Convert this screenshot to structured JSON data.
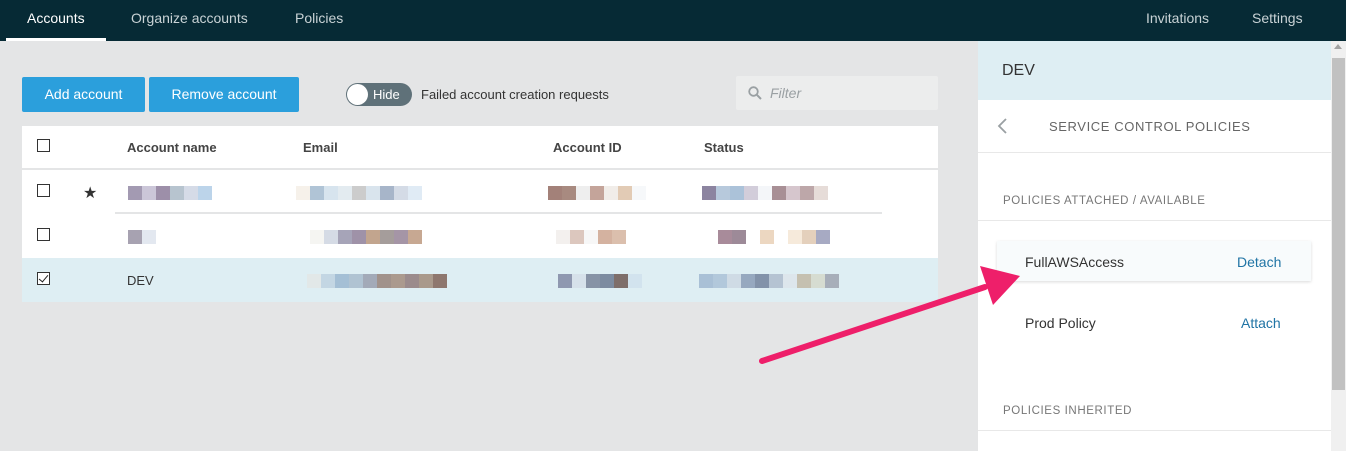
{
  "nav": {
    "left": [
      "Accounts",
      "Organize accounts",
      "Policies"
    ],
    "right": [
      "Invitations",
      "Settings"
    ],
    "active": "Accounts"
  },
  "toolbar": {
    "add_label": "Add account",
    "remove_label": "Remove account",
    "toggle_label": "Hide",
    "toggle_caption": "Failed account creation requests",
    "filter_placeholder": "Filter"
  },
  "table": {
    "columns": [
      "Account name",
      "Email",
      "Account ID",
      "Status"
    ],
    "rows": [
      {
        "checked": false,
        "starred": true,
        "name": "",
        "selected": false
      },
      {
        "checked": false,
        "starred": false,
        "name": "",
        "selected": false
      },
      {
        "checked": true,
        "starred": false,
        "name": "DEV",
        "selected": true
      }
    ]
  },
  "panel": {
    "title": "DEV",
    "subtitle": "SERVICE CONTROL POLICIES",
    "section_attached": "POLICIES ATTACHED / AVAILABLE",
    "policies": [
      {
        "name": "FullAWSAccess",
        "action": "Detach"
      },
      {
        "name": "Prod Policy",
        "action": "Attach"
      }
    ],
    "section_inherited": "POLICIES INHERITED"
  },
  "colors": {
    "nav_bg": "#062a35",
    "button": "#2b9fdc",
    "link": "#2074a5",
    "annotation_arrow": "#ee1f6a"
  }
}
